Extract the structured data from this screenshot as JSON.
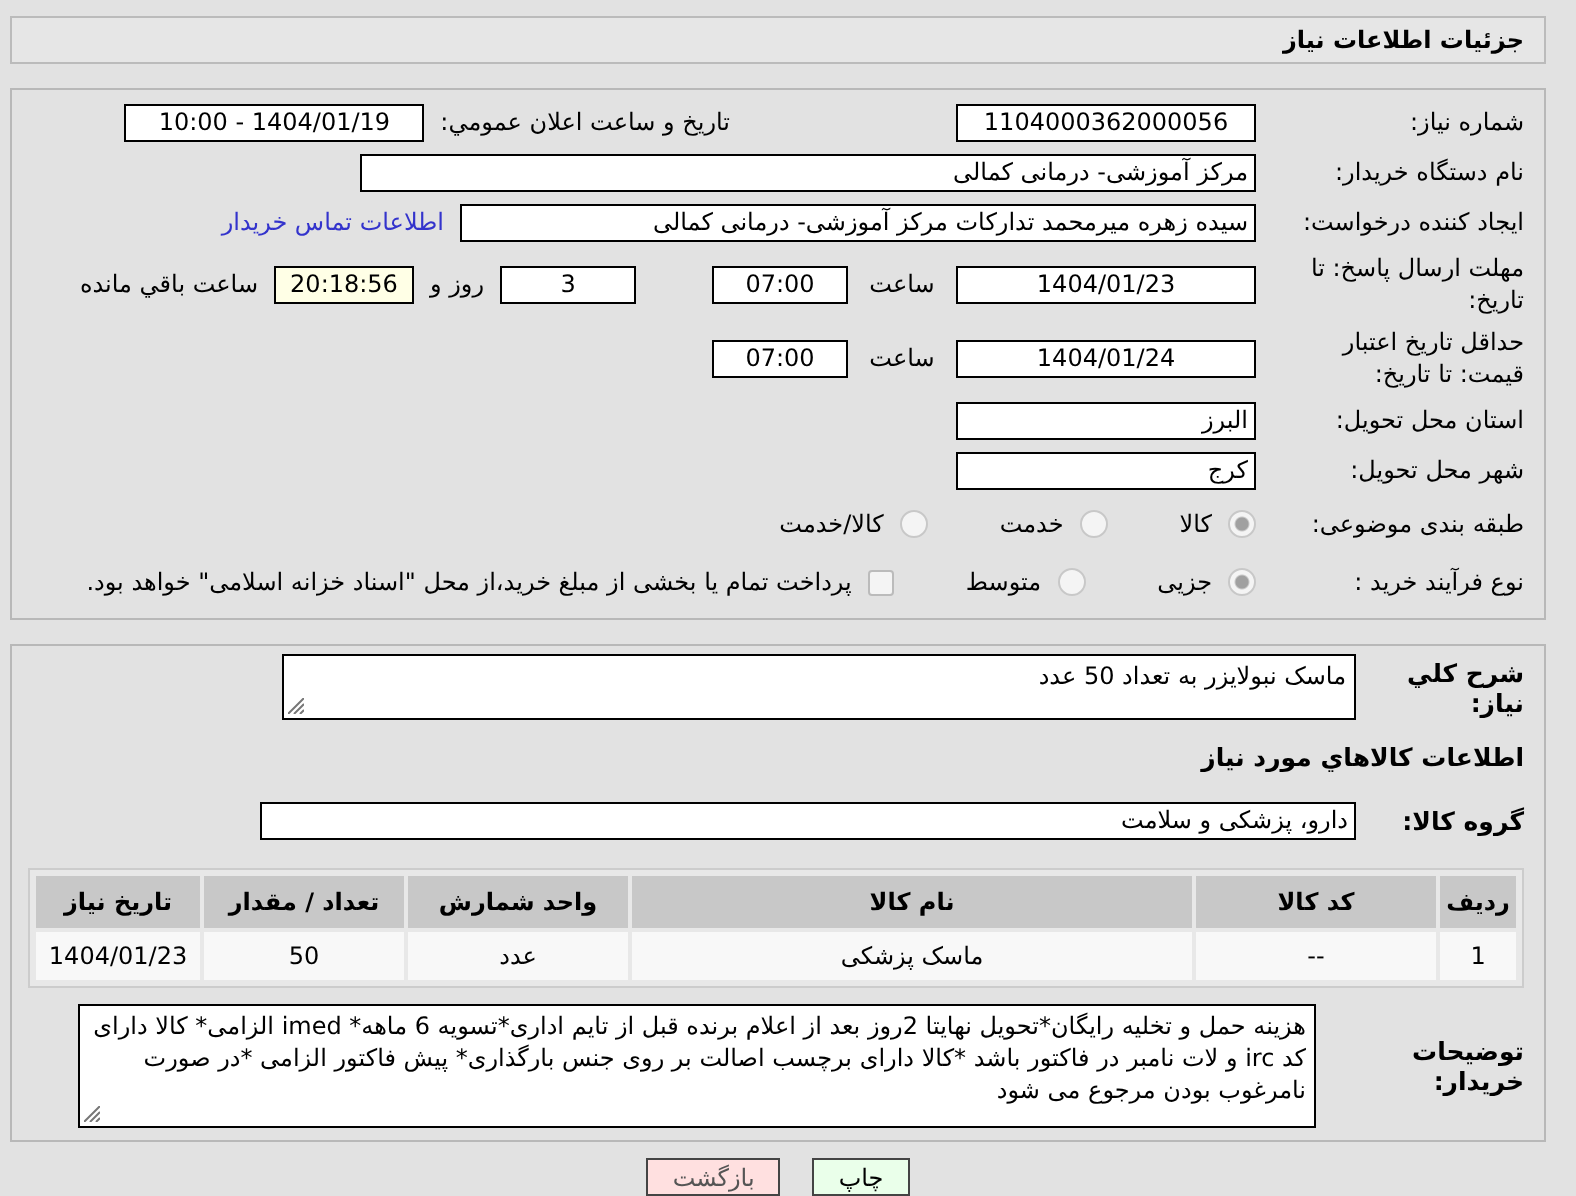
{
  "title": "جزئیات اطلاعات نیاز",
  "need_number": {
    "label": "شماره نیاز:",
    "value": "1104000362000056"
  },
  "announce": {
    "label": "تاریخ و ساعت اعلان عمومي:",
    "value": "1404/01/19 - 10:00"
  },
  "buyer": {
    "label": "نام دستگاه خریدار:",
    "value": "مرکز آموزشی- درمانی کمالی"
  },
  "creator": {
    "label": "ایجاد کننده درخواست:",
    "value": "سیده زهره میرمحمد تدارکات مرکز آموزشی- درمانی کمالی",
    "link": "اطلاعات تماس خریدار"
  },
  "deadline": {
    "label": "مهلت ارسال پاسخ: تا تاریخ:",
    "date": "1404/01/23",
    "time_label": "ساعت",
    "time": "07:00",
    "days": "3",
    "days_label": "روز و",
    "remaining": "20:18:56",
    "remaining_label": "ساعت باقي مانده"
  },
  "validity": {
    "label": "حداقل تاریخ اعتبار قیمت: تا تاریخ:",
    "date": "1404/01/24",
    "time_label": "ساعت",
    "time": "07:00"
  },
  "province": {
    "label": "استان محل تحویل:",
    "value": "البرز"
  },
  "city": {
    "label": "شهر محل تحویل:",
    "value": "کرج"
  },
  "category": {
    "label": "طبقه بندی موضوعی:",
    "options": [
      {
        "label": "کالا",
        "selected": true
      },
      {
        "label": "خدمت",
        "selected": false
      },
      {
        "label": "کالا/خدمت",
        "selected": false
      }
    ]
  },
  "process": {
    "label": "نوع فرآیند خرید :",
    "options": [
      {
        "label": "جزیی",
        "selected": true
      },
      {
        "label": "متوسط",
        "selected": false
      }
    ],
    "payment": {
      "label": "پرداخت تمام یا بخشی از مبلغ خرید،از محل \"اسناد خزانه اسلامی\" خواهد بود.",
      "checked": false
    }
  },
  "description": {
    "label": "شرح کلي نیاز:",
    "value": "ماسک نبولایزر به تعداد 50 عدد"
  },
  "goods_heading": "اطلاعات کالاهاي مورد نیاز",
  "goods_group": {
    "label": "گروه کالا:",
    "value": "دارو، پزشکی و سلامت"
  },
  "table": {
    "columns": [
      "ردیف",
      "کد کالا",
      "نام کالا",
      "واحد شمارش",
      "تعداد / مقدار",
      "تاریخ نیاز"
    ],
    "rows": [
      [
        "1",
        "--",
        "ماسک پزشکی",
        "عدد",
        "50",
        "1404/01/23"
      ]
    ]
  },
  "buyer_notes": {
    "label": "توضیحات خریدار:",
    "value": "هزینه حمل و تخلیه رایگان*تحویل نهایتا 2روز بعد از اعلام برنده قبل از تایم اداری*تسویه 6 ماهه* imed الزامی* کالا دارای کد irc و لات نامبر در فاکتور باشد *کالا دارای برچسب اصالت بر روی جنس بارگذاری* پیش فاکتور الزامی *در صورت نامرغوب بودن مرجوع می شود"
  },
  "buttons": [
    {
      "label": "چاپ",
      "kind": "print"
    },
    {
      "label": "بازگشت",
      "kind": "back"
    }
  ]
}
